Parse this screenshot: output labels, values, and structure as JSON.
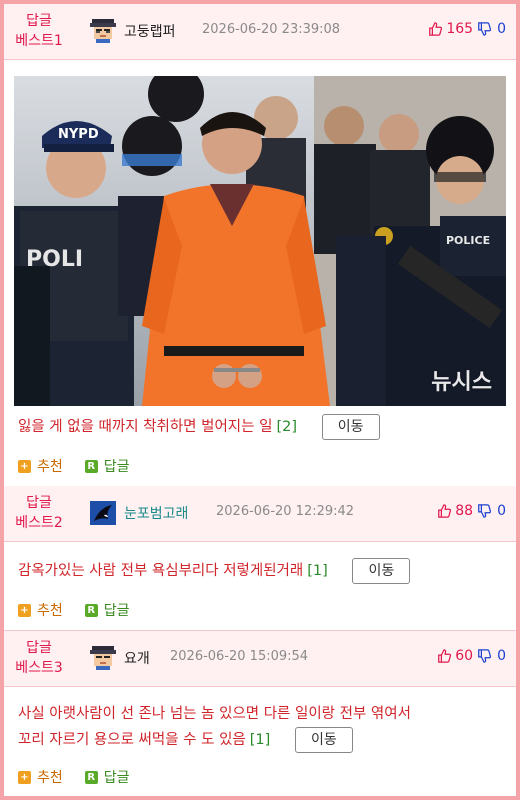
{
  "posts": [
    {
      "rank_line1": "답글",
      "rank_line2": "베스트1",
      "username": "고둥랩퍼",
      "datetime": "2026-06-20 23:39:08",
      "upvotes": "165",
      "downvotes": "0",
      "text": "잃을 게 없을 때까지 착취하면 벌어지는 일",
      "comment_count": "[2]",
      "move_label": "이동",
      "recommend_label": "추천",
      "reply_label": "답글",
      "image_watermark": "뉴시스"
    },
    {
      "rank_line1": "답글",
      "rank_line2": "베스트2",
      "username": "눈포범고래",
      "datetime": "2026-06-20 12:29:42",
      "upvotes": "88",
      "downvotes": "0",
      "text": "감옥가있는 사람 전부 욕심부리다 저렇게된거래",
      "comment_count": "[1]",
      "move_label": "이동",
      "recommend_label": "추천",
      "reply_label": "답글"
    },
    {
      "rank_line1": "답글",
      "rank_line2": "베스트3",
      "username": "요개",
      "datetime": "2026-06-20 15:09:54",
      "upvotes": "60",
      "downvotes": "0",
      "text_line1": "사실 아랫사람이 선 존나 넘는 놈 있으면 다른 일이랑 전부 엮여서",
      "text_line2": "꼬리 자르기 용으로 써먹을 수 도 있음",
      "comment_count": "[1]",
      "move_label": "이동",
      "recommend_label": "추천",
      "reply_label": "답글"
    }
  ],
  "colors": {
    "page_border": "#f4a4a8",
    "header_bg": "#fff0f1",
    "rank_text": "#e0184c",
    "body_text": "#d0252b",
    "upvote": "#e0184c",
    "downvote": "#1a3fd0",
    "comment_count": "#2a8a2a"
  },
  "icons": {
    "upvote": "thumbs-up-outline-icon",
    "downvote": "thumbs-down-outline-icon",
    "recommend": "plus-square-icon",
    "reply": "r-square-icon"
  }
}
